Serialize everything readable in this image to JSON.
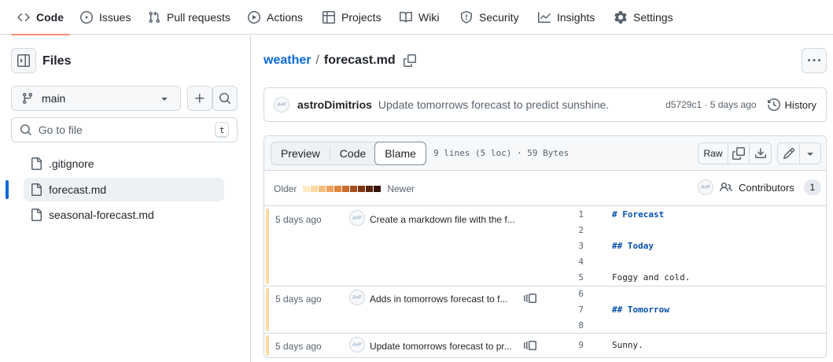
{
  "nav": {
    "tabs": [
      {
        "label": "Code",
        "icon": "code-icon",
        "active": true
      },
      {
        "label": "Issues",
        "icon": "issue-opened-icon"
      },
      {
        "label": "Pull requests",
        "icon": "git-pull-request-icon"
      },
      {
        "label": "Actions",
        "icon": "play-icon"
      },
      {
        "label": "Projects",
        "icon": "table-icon"
      },
      {
        "label": "Wiki",
        "icon": "book-icon"
      },
      {
        "label": "Security",
        "icon": "shield-icon"
      },
      {
        "label": "Insights",
        "icon": "graph-icon"
      },
      {
        "label": "Settings",
        "icon": "gear-icon"
      }
    ]
  },
  "sidebar": {
    "title": "Files",
    "branch": "main",
    "goto_placeholder": "Go to file",
    "goto_shortcut": "t",
    "files": [
      {
        "name": ".gitignore"
      },
      {
        "name": "forecast.md",
        "selected": true
      },
      {
        "name": "seasonal-forecast.md"
      }
    ]
  },
  "breadcrumb": {
    "repo": "weather",
    "separator": "/",
    "file": "forecast.md"
  },
  "latest_commit": {
    "avatar": "A•P",
    "author": "astroDimitrios",
    "message": "Update tomorrows forecast to predict sunshine.",
    "sha_age": "d5729c1 · 5 days ago",
    "history_label": "History"
  },
  "viewer": {
    "views": [
      "Preview",
      "Code",
      "Blame"
    ],
    "active_view": "Blame",
    "meta": "9 lines (5 loc) · 59 Bytes",
    "raw_label": "Raw",
    "legend_older": "Older",
    "legend_newer": "Newer",
    "legend_colors": [
      "#fdebc6",
      "#fcd7a2",
      "#f6bd7c",
      "#eea25c",
      "#e0873f",
      "#c96a2b",
      "#a64f1c",
      "#7e3712",
      "#57230a",
      "#311204"
    ],
    "contributors_label": "Contributors",
    "contributors_count": "1"
  },
  "blame": {
    "hunks": [
      {
        "time": "5 days ago",
        "avatar": "A•P",
        "message": "Create a markdown file with the f...",
        "reblame": false,
        "lines": [
          {
            "n": "1",
            "code": "# Forecast",
            "heading": true
          },
          {
            "n": "2",
            "code": ""
          },
          {
            "n": "3",
            "code": "## Today",
            "heading": true
          },
          {
            "n": "4",
            "code": ""
          },
          {
            "n": "5",
            "code": "Foggy and cold."
          }
        ]
      },
      {
        "time": "5 days ago",
        "avatar": "A•P",
        "message": "Adds in tomorrows forecast to f...",
        "reblame": true,
        "lines": [
          {
            "n": "6",
            "code": ""
          },
          {
            "n": "7",
            "code": "## Tomorrow",
            "heading": true
          },
          {
            "n": "8",
            "code": ""
          }
        ]
      },
      {
        "time": "5 days ago",
        "avatar": "A•P",
        "message": "Update tomorrows forecast to pr...",
        "reblame": true,
        "lines": [
          {
            "n": "9",
            "code": "Sunny."
          }
        ]
      }
    ]
  }
}
